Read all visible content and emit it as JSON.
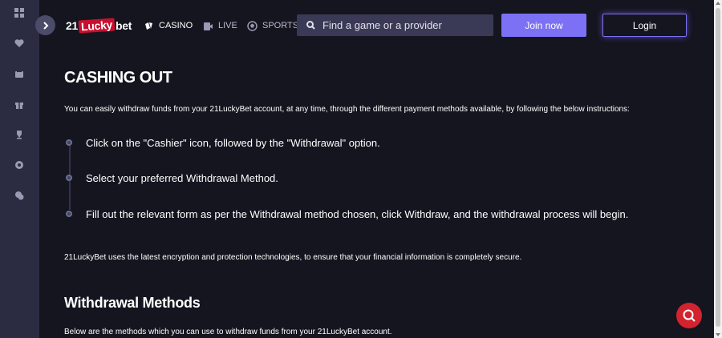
{
  "header": {
    "logo": {
      "left": "21",
      "mid": "Lucky",
      "right": "bet"
    },
    "nav": [
      {
        "label": "CASINO",
        "icon": "cards-icon"
      },
      {
        "label": "LIVE",
        "icon": "live-icon"
      },
      {
        "label": "SPORTS",
        "icon": "soccer-ball-icon"
      }
    ],
    "search_placeholder": "Find a game or a provider",
    "join_label": "Join now",
    "login_label": "Login"
  },
  "sidebar": {
    "icons": [
      "grid-icon",
      "heart-icon",
      "promotions-icon",
      "gift-icon",
      "trophy-icon",
      "vip-icon",
      "chat-icon"
    ]
  },
  "content": {
    "title": "CASHING OUT",
    "intro": "You can easily withdraw funds from your 21LuckyBet account, at any time, through the different payment methods available, by following the below instructions:",
    "steps": [
      "Click on the \"Cashier\" icon, followed by the \"Withdrawal\" option.",
      "Select your preferred Withdrawal Method.",
      "Fill out the relevant form as per the Withdrawal method chosen, click Withdraw, and the withdrawal process will begin."
    ],
    "note": "21LuckyBet uses the latest encryption and protection technologies, to ensure that your financial information is completely secure.",
    "section_title": "Withdrawal Methods",
    "section_intro": "Below are the methods which you can use to withdraw funds from your 21LuckyBet account."
  },
  "colors": {
    "background": "#151520",
    "sidebar": "#2b2b42",
    "accent": "#7c71f5",
    "help": "#d3232f",
    "logo_red": "#c8102e"
  }
}
